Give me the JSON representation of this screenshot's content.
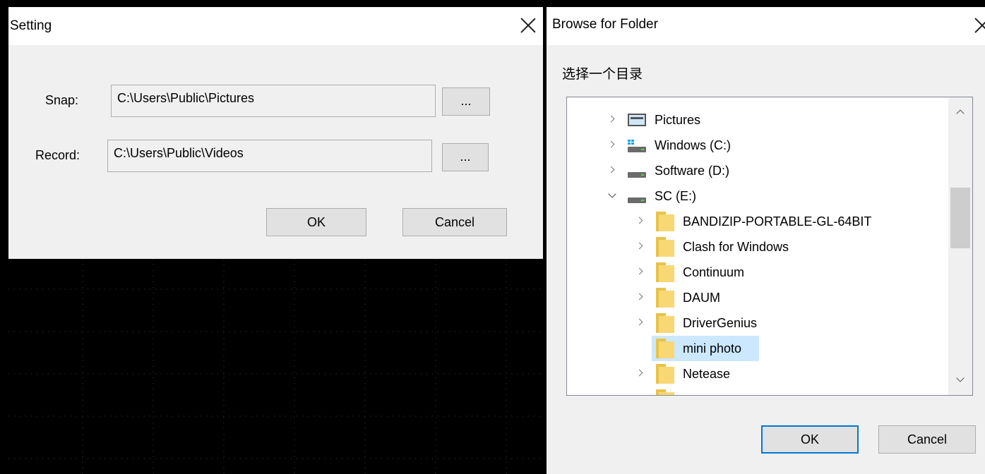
{
  "setting_dialog": {
    "title": "Setting",
    "snap_label": "Snap:",
    "snap_path": "C:\\Users\\Public\\Pictures",
    "record_label": "Record:",
    "record_path": "C:\\Users\\Public\\Videos",
    "browse_label": "...",
    "ok_label": "OK",
    "cancel_label": "Cancel"
  },
  "browse_dialog": {
    "title": "Browse for Folder",
    "instruction": "选择一个目录",
    "ok_label": "OK",
    "cancel_label": "Cancel",
    "tree": [
      {
        "label": "Pictures",
        "icon": "pictures-icon",
        "expander": "collapsed"
      },
      {
        "label": "Windows (C:)",
        "icon": "system-drive-icon",
        "expander": "collapsed"
      },
      {
        "label": "Software (D:)",
        "icon": "drive-icon",
        "expander": "collapsed"
      },
      {
        "label": "SC (E:)",
        "icon": "drive-icon",
        "expander": "expanded"
      },
      {
        "label": "BANDIZIP-PORTABLE-GL-64BIT",
        "icon": "folder-icon",
        "expander": "collapsed"
      },
      {
        "label": "Clash for Windows",
        "icon": "folder-icon",
        "expander": "collapsed"
      },
      {
        "label": "Continuum",
        "icon": "folder-icon",
        "expander": "collapsed"
      },
      {
        "label": "DAUM",
        "icon": "folder-icon",
        "expander": "collapsed"
      },
      {
        "label": "DriverGenius",
        "icon": "folder-icon",
        "expander": "collapsed"
      },
      {
        "label": "mini photo",
        "icon": "folder-icon",
        "expander": "none",
        "selected": true
      },
      {
        "label": "Netease",
        "icon": "folder-icon",
        "expander": "collapsed"
      }
    ]
  },
  "colors": {
    "selection": "#cce8ff",
    "dialog_bg": "#f0f0f0",
    "scope_bg": "#000000",
    "folder_yellow": "#f8d775"
  }
}
